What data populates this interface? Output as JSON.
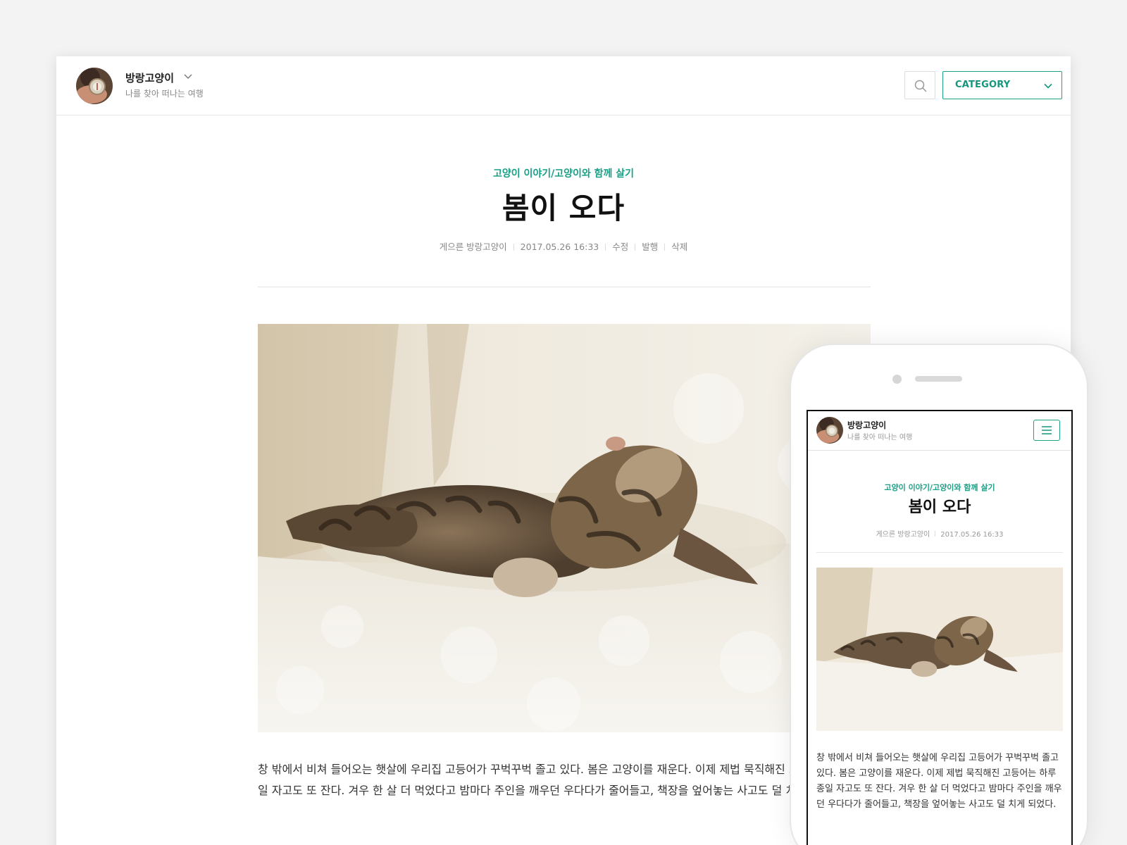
{
  "colors": {
    "accent": "#1aa388",
    "background": "#f3f3f3"
  },
  "blog": {
    "name": "방랑고양이",
    "tagline": "나를 찾아 떠나는 여행",
    "avatar_icon": "compass-avatar"
  },
  "header": {
    "search_icon": "search-icon",
    "category_label": "CATEGORY",
    "category_icon": "chevron-down-icon",
    "blog_menu_icon": "chevron-down-icon"
  },
  "post": {
    "breadcrumb": "고양이 이야기/고양이와 함께 살기",
    "title": "봄이 오다",
    "author": "게으른 방랑고양이",
    "date": "2017.05.26 16:33",
    "actions": {
      "edit": "수정",
      "publish": "발행",
      "delete": "삭제"
    },
    "image_alt": "sleeping-kitten-photo",
    "desktop_body": "창 밖에서 비쳐 들어오는 햇살에 우리집 고등어가 꾸벅꾸벅 졸고 있다. 봄은 고양이를 재운다. 이제 제법 묵직해진 고등어는 하루 종일 자고도 또 잔다. 겨우 한 살 더 먹었다고 밤마다 주인을 깨우던 우다다가 줄어들고, 책장을 엎어놓는 사고도 덜 치게 되었다."
  },
  "mobile": {
    "blog_name": "방랑고양이",
    "tagline": "나를 찾아 떠나는 여행",
    "menu_icon": "hamburger-menu-icon",
    "breadcrumb": "고양이 이야기/고양이와 함께 살기",
    "title": "봄이 오다",
    "author": "게으른 방랑고양이",
    "date": "2017.05.26 16:33",
    "body": "창 밖에서 비쳐 들어오는 햇살에 우리집 고등어가 꾸벅꾸벅 졸고 있다. 봄은 고양이를 재운다. 이제 제법 묵직해진 고등어는 하루 종일 자고도 또 잔다. 겨우 한 살 더 먹었다고 밤마다 주인을 깨우던 우다다가 줄어들고, 책장을 엎어놓는 사고도 덜 치게 되었다."
  }
}
